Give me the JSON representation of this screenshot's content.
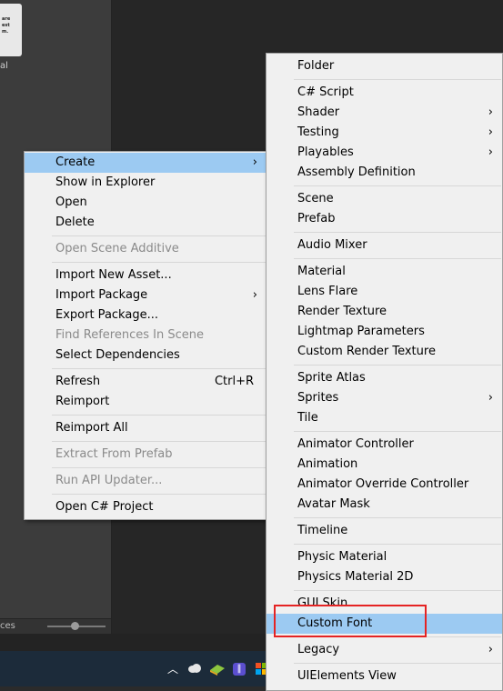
{
  "project_panel": {
    "asset_thumb_text": "are\nest\nm.",
    "asset_label": "al",
    "bottom_text": "ces"
  },
  "main_menu": [
    {
      "label": "Create",
      "submenu": true,
      "highlight": true
    },
    {
      "label": "Show in Explorer"
    },
    {
      "label": "Open"
    },
    {
      "label": "Delete"
    },
    {
      "separator": true
    },
    {
      "label": "Open Scene Additive",
      "disabled": true
    },
    {
      "separator": true
    },
    {
      "label": "Import New Asset..."
    },
    {
      "label": "Import Package",
      "submenu": true
    },
    {
      "label": "Export Package..."
    },
    {
      "label": "Find References In Scene",
      "disabled": true
    },
    {
      "label": "Select Dependencies"
    },
    {
      "separator": true
    },
    {
      "label": "Refresh",
      "shortcut": "Ctrl+R"
    },
    {
      "label": "Reimport"
    },
    {
      "separator": true
    },
    {
      "label": "Reimport All"
    },
    {
      "separator": true
    },
    {
      "label": "Extract From Prefab",
      "disabled": true
    },
    {
      "separator": true
    },
    {
      "label": "Run API Updater...",
      "disabled": true
    },
    {
      "separator": true
    },
    {
      "label": "Open C# Project"
    }
  ],
  "create_submenu": [
    {
      "label": "Folder"
    },
    {
      "separator": true
    },
    {
      "label": "C# Script"
    },
    {
      "label": "Shader",
      "submenu": true
    },
    {
      "label": "Testing",
      "submenu": true
    },
    {
      "label": "Playables",
      "submenu": true
    },
    {
      "label": "Assembly Definition"
    },
    {
      "separator": true
    },
    {
      "label": "Scene"
    },
    {
      "label": "Prefab"
    },
    {
      "separator": true
    },
    {
      "label": "Audio Mixer"
    },
    {
      "separator": true
    },
    {
      "label": "Material"
    },
    {
      "label": "Lens Flare"
    },
    {
      "label": "Render Texture"
    },
    {
      "label": "Lightmap Parameters"
    },
    {
      "label": "Custom Render Texture"
    },
    {
      "separator": true
    },
    {
      "label": "Sprite Atlas"
    },
    {
      "label": "Sprites",
      "submenu": true
    },
    {
      "label": "Tile"
    },
    {
      "separator": true
    },
    {
      "label": "Animator Controller"
    },
    {
      "label": "Animation"
    },
    {
      "label": "Animator Override Controller"
    },
    {
      "label": "Avatar Mask"
    },
    {
      "separator": true
    },
    {
      "label": "Timeline"
    },
    {
      "separator": true
    },
    {
      "label": "Physic Material"
    },
    {
      "label": "Physics Material 2D"
    },
    {
      "separator": true
    },
    {
      "label": "GUI Skin"
    },
    {
      "label": "Custom Font",
      "highlight": true
    },
    {
      "separator": true
    },
    {
      "label": "Legacy",
      "submenu": true
    },
    {
      "separator": true
    },
    {
      "label": "UIElements View"
    }
  ],
  "colors": {
    "highlight": "#9ccaf2",
    "annotation_box": "#e52323",
    "menu_bg": "#f0f0f0"
  },
  "icons": {
    "submenu_arrow": "›",
    "tray": [
      "chevron-up-icon",
      "cloud-icon",
      "app-icon-green",
      "app-icon-purple",
      "windows-icon"
    ]
  }
}
